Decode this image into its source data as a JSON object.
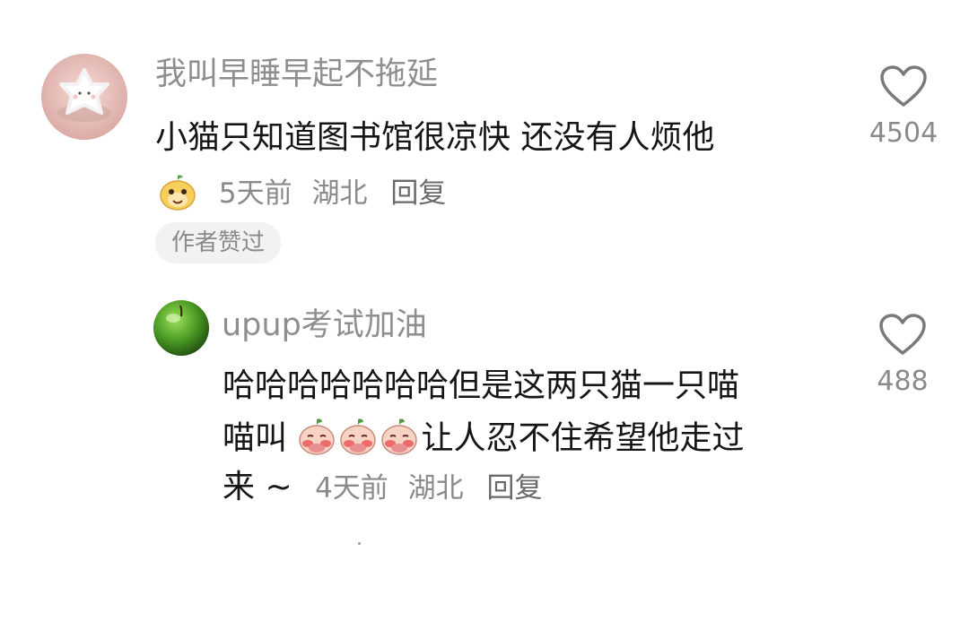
{
  "comments": [
    {
      "username": "我叫早睡早起不拖延",
      "text": "小猫只知道图书馆很凉快 还没有人烦他",
      "time": "5天前",
      "location": "湖北",
      "reply_label": "回复",
      "like_count": "4504",
      "author_badge": "作者赞过"
    },
    {
      "username": "upup考试加油",
      "text_line1": "哈哈哈哈哈哈哈但是这两只猫一只喵",
      "text_line2_pre": "喵叫",
      "text_line2_post": "让人忍不住希望他走过",
      "text_line3": "来 ~",
      "time": "4天前",
      "location": "湖北",
      "reply_label": "回复",
      "like_count": "488"
    }
  ]
}
